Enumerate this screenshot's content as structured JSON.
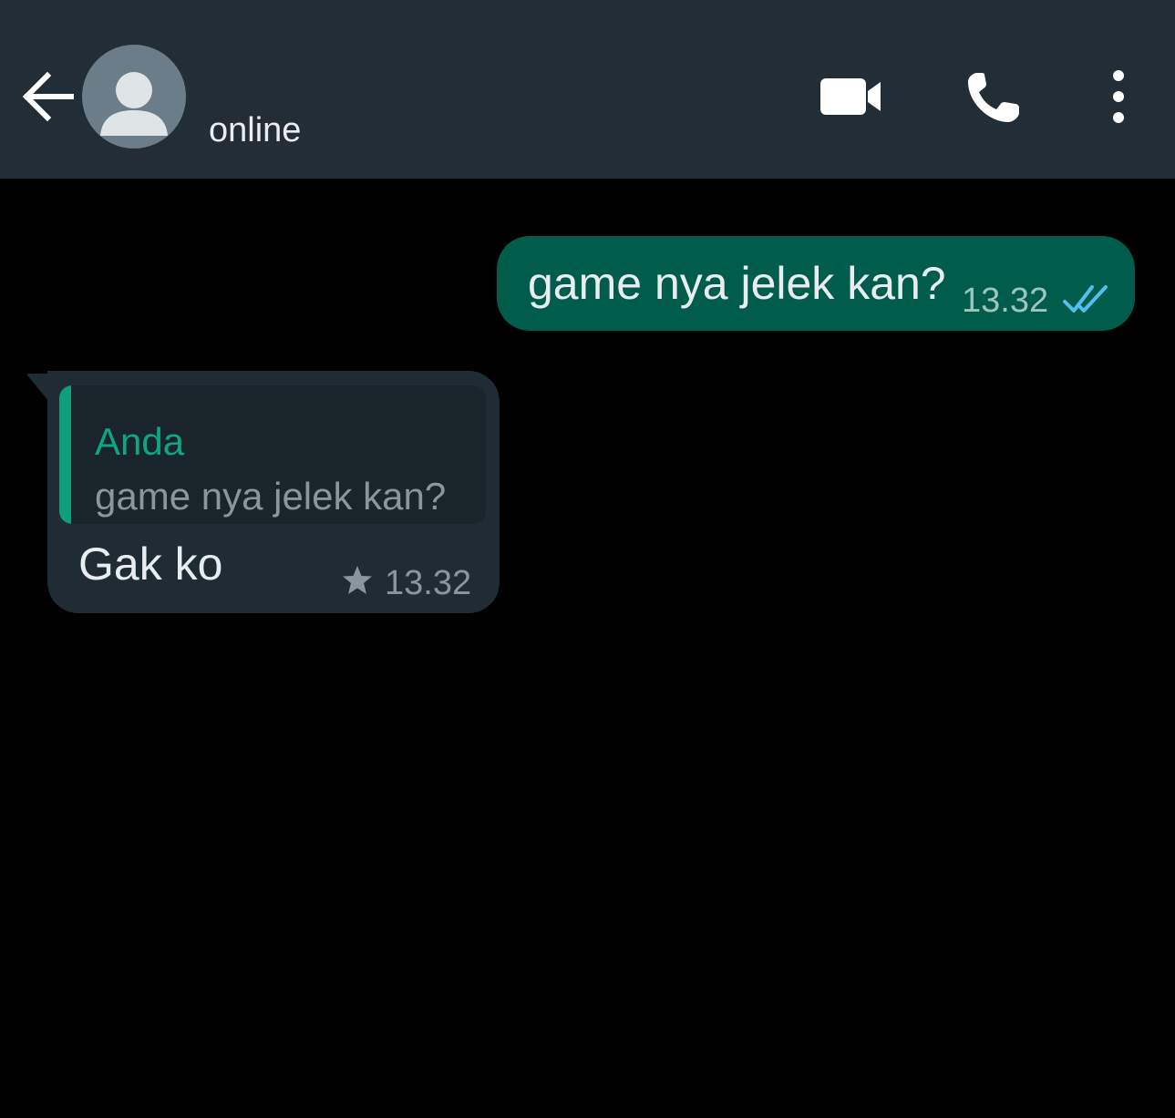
{
  "header": {
    "status": "online",
    "icons": {
      "back": "arrow-left-icon",
      "avatar": "default-avatar-icon",
      "video": "video-call-icon",
      "call": "phone-icon",
      "menu": "more-vertical-icon"
    }
  },
  "messages": [
    {
      "direction": "outgoing",
      "text": "game nya jelek kan?",
      "time": "13.32",
      "status_icon": "double-check-read-icon"
    },
    {
      "direction": "incoming",
      "quoted": {
        "author": "Anda",
        "text": "game nya jelek kan?"
      },
      "text": "Gak ko",
      "time": "13.32",
      "starred": true,
      "star_icon": "star-icon"
    }
  ],
  "colors": {
    "header_bg": "#222d35",
    "chat_bg": "#000000",
    "outgoing_bubble": "#005c4b",
    "incoming_bubble": "#202c33",
    "accent_green": "#0ea583",
    "read_ticks": "#53bdeb"
  }
}
